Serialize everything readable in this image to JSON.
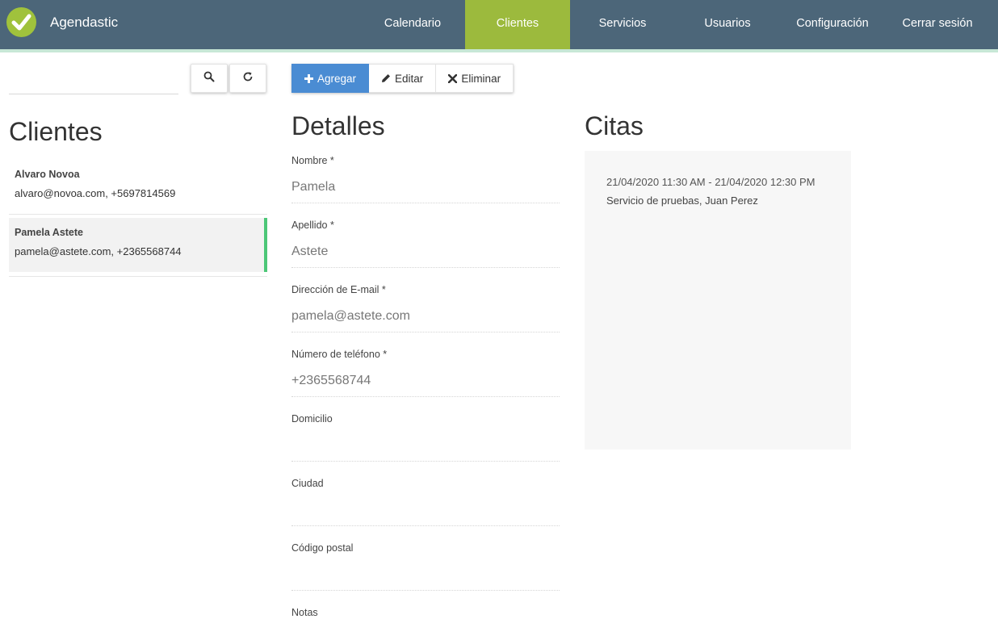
{
  "app": {
    "name": "Agendastic",
    "brand_color": "#4c6679",
    "accent_color": "#9cba3d",
    "logo_icon": "check-circle-icon"
  },
  "nav": {
    "items": [
      {
        "label": "Calendario",
        "active": false
      },
      {
        "label": "Clientes",
        "active": true
      },
      {
        "label": "Servicios",
        "active": false
      },
      {
        "label": "Usuarios",
        "active": false
      },
      {
        "label": "Configuración",
        "active": false
      },
      {
        "label": "Cerrar sesión",
        "active": false
      }
    ]
  },
  "filter": {
    "value": "",
    "placeholder": "",
    "search_icon": "search-icon",
    "reload_icon": "reload-icon"
  },
  "clients": {
    "title": "Clientes",
    "items": [
      {
        "name": "Alvaro Novoa",
        "info": "alvaro@novoa.com, +5697814569",
        "selected": false
      },
      {
        "name": "Pamela Astete",
        "info": "pamela@astete.com, +2365568744",
        "selected": true
      }
    ]
  },
  "toolbar": {
    "add_label": "Agregar",
    "edit_label": "Editar",
    "delete_label": "Eliminar",
    "add_color": "#4a8cd3"
  },
  "details": {
    "title": "Detalles",
    "fields": [
      {
        "label": "Nombre *",
        "value": "Pamela"
      },
      {
        "label": "Apellido *",
        "value": "Astete"
      },
      {
        "label": "Dirección de E-mail *",
        "value": "pamela@astete.com"
      },
      {
        "label": "Número de teléfono *",
        "value": "+2365568744"
      },
      {
        "label": "Domicilio",
        "value": ""
      },
      {
        "label": "Ciudad",
        "value": ""
      },
      {
        "label": "Código postal",
        "value": ""
      },
      {
        "label": "Notas",
        "value": ""
      }
    ]
  },
  "appointments": {
    "title": "Citas",
    "items": [
      {
        "time": "21/04/2020 11:30 AM - 21/04/2020 12:30 PM",
        "description": "Servicio de pruebas, Juan Perez"
      }
    ]
  }
}
